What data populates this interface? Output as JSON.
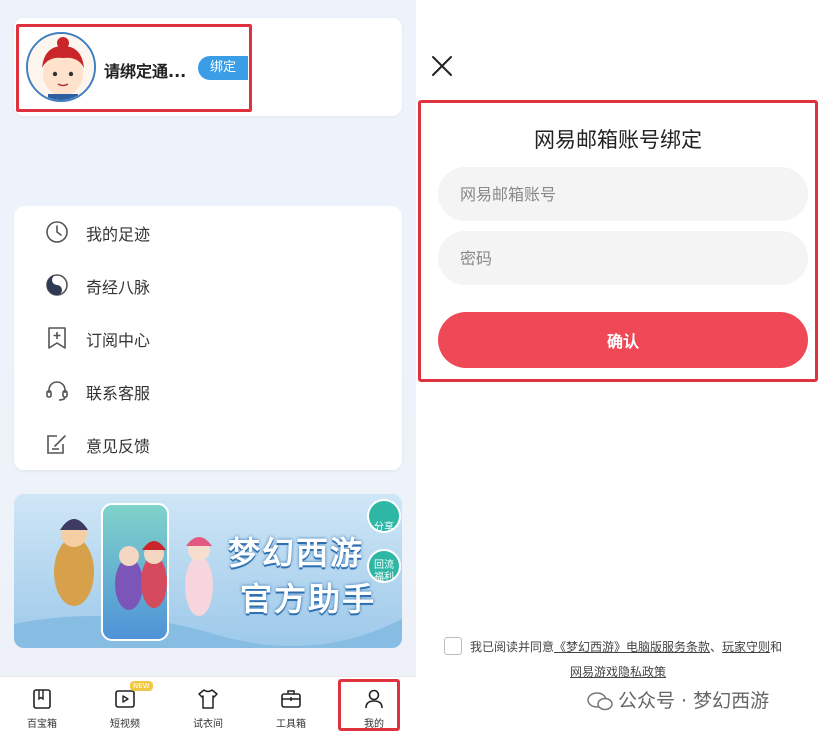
{
  "profile": {
    "name": "请绑定通...",
    "bind_label": "绑定"
  },
  "menu": {
    "items": [
      {
        "label": "我的足迹",
        "icon": "clock-icon"
      },
      {
        "label": "奇经八脉",
        "icon": "yin-yang-icon"
      },
      {
        "label": "订阅中心",
        "icon": "bookmark-plus-icon"
      },
      {
        "label": "联系客服",
        "icon": "headset-icon"
      },
      {
        "label": "意见反馈",
        "icon": "edit-note-icon"
      }
    ]
  },
  "banner": {
    "title_line1": "梦幻西游",
    "title_line2": "官方助手",
    "share_label": "分享",
    "reward_label1": "回流",
    "reward_label2": "福利"
  },
  "tabbar": {
    "tabs": [
      {
        "label": "百宝箱",
        "icon": "book-icon"
      },
      {
        "label": "短视频",
        "icon": "video-play-icon",
        "badge": "NEW"
      },
      {
        "label": "试衣间",
        "icon": "shirt-icon"
      },
      {
        "label": "工具箱",
        "icon": "toolbox-icon"
      },
      {
        "label": "我的",
        "icon": "person-icon"
      }
    ]
  },
  "form": {
    "title": "网易邮箱账号绑定",
    "account_placeholder": "网易邮箱账号",
    "password_placeholder": "密码",
    "confirm_label": "确认"
  },
  "agreement": {
    "prefix": "我已阅读并同意",
    "link1": "《梦幻西游》电脑版服务条款",
    "sep": "、",
    "link2": "玩家守则",
    "and": "和",
    "link3": "网易游戏隐私政策"
  },
  "watermark": {
    "text": "公众号 · 梦幻西游"
  },
  "colors": {
    "accent_red": "#ef4856",
    "highlight_red": "#e0323e",
    "bind_blue": "#3a9ee6"
  }
}
